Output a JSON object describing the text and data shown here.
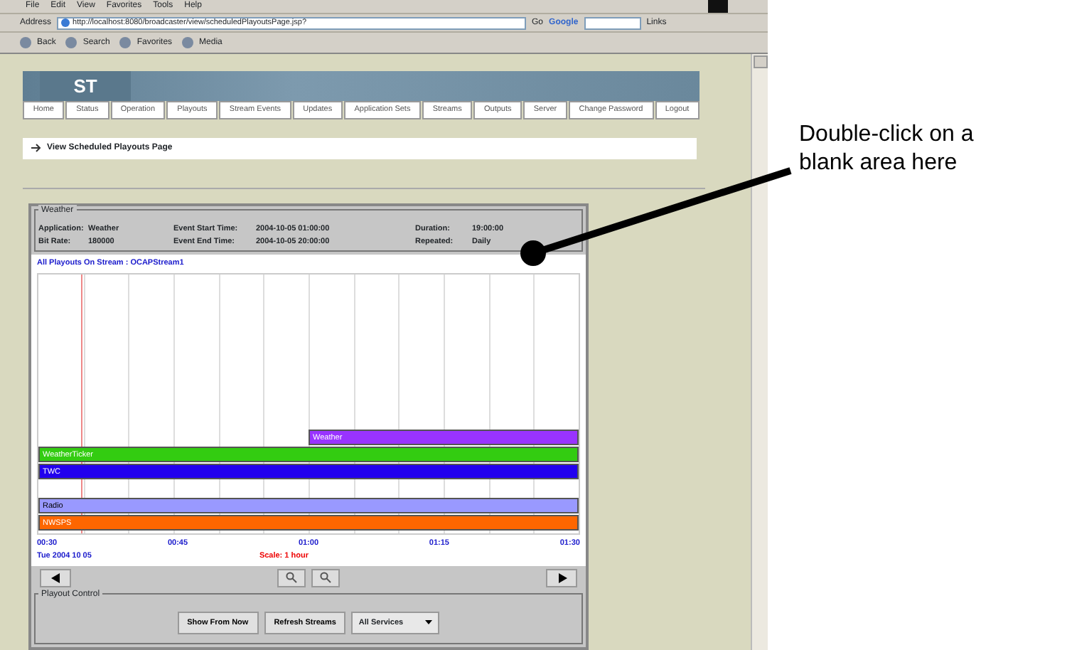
{
  "browser": {
    "menu": [
      "File",
      "Edit",
      "View",
      "Favorites",
      "Tools",
      "Help"
    ],
    "address_label": "Address",
    "url": "http://localhost:8080/broadcaster/view/scheduledPlayoutsPage.jsp?",
    "go": "Go",
    "search_brand": "Google",
    "links": "Links",
    "toolbar": [
      "Back",
      "Search",
      "Favorites",
      "Media"
    ]
  },
  "site": {
    "logo": "ST",
    "nav": [
      {
        "label": "Home"
      },
      {
        "label": "Status"
      },
      {
        "label": "Operation"
      },
      {
        "label": "Playouts"
      },
      {
        "label": "Stream Events"
      },
      {
        "label": "Updates"
      },
      {
        "label": "Application Sets"
      },
      {
        "label": "Streams"
      },
      {
        "label": "Outputs"
      },
      {
        "label": "Server"
      },
      {
        "label": "Change Password"
      },
      {
        "label": "Logout"
      }
    ],
    "breadcrumb": "View Scheduled Playouts Page"
  },
  "panel": {
    "legend": "Weather",
    "info": [
      {
        "label": "Application:",
        "value": "Weather"
      },
      {
        "label": "Event Start Time:",
        "value": "2004-10-05 01:00:00"
      },
      {
        "label": "Duration:",
        "value": "19:00:00"
      },
      {
        "label": "Bit Rate:",
        "value": "180000"
      },
      {
        "label": "Event End Time:",
        "value": "2004-10-05 20:00:00"
      },
      {
        "label": "Repeated:",
        "value": "Daily"
      }
    ],
    "chart_title": "All Playouts On Stream : OCAPStream1",
    "playouts": [
      {
        "label": "Weather",
        "color": "#9933ff",
        "level": 0.5,
        "kind": "bar"
      },
      {
        "label": "WeatherTicker",
        "color": "#33cc11",
        "level": 1,
        "kind": "bar"
      },
      {
        "label": "TWC",
        "color": "#2200ee",
        "level": 1,
        "kind": "bar"
      },
      {
        "kind": "gap"
      },
      {
        "label": "Radio",
        "color": "#9999ff",
        "level": 1,
        "kind": "bar"
      },
      {
        "label": "NWSPS",
        "color": "#ff6600",
        "level": 1,
        "kind": "bar"
      }
    ],
    "times": [
      "00:30",
      "00:45",
      "01:00",
      "01:15",
      "01:30"
    ],
    "date": "Tue 2004 10 05",
    "scale": "Scale: 1 hour",
    "control_legend": "Playout Control",
    "buttons": [
      "Show From Now",
      "Refresh Streams"
    ],
    "service": "All Services"
  },
  "callout": "Double-click on a blank area here"
}
